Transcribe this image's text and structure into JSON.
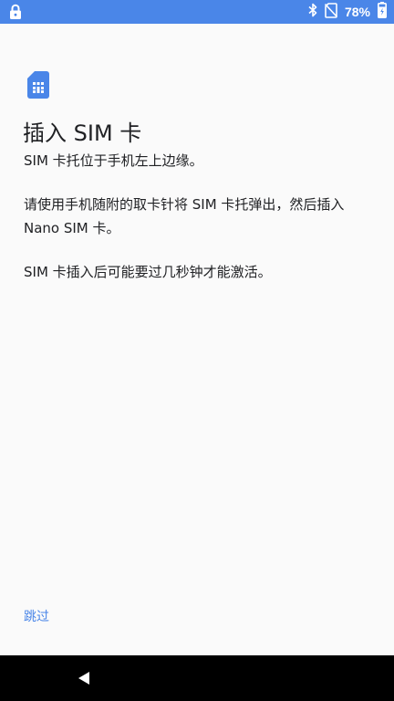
{
  "status_bar": {
    "lock_icon": "lock-icon",
    "bluetooth_icon": "bluetooth-icon",
    "no_sim_icon": "no-sim-icon",
    "battery_percent": "78%",
    "battery_icon": "battery-charging-icon",
    "background_color": "#4a86e8"
  },
  "main": {
    "icon": "sim-card-icon",
    "accent_color": "#4a86e8",
    "title": "插入 SIM 卡",
    "paragraphs": [
      "SIM 卡托位于手机左上边缘。",
      "请使用手机随附的取卡针将 SIM 卡托弹出，然后插入 Nano SIM 卡。",
      "SIM 卡插入后可能要过几秒钟才能激活。"
    ],
    "skip_label": "跳过"
  },
  "nav_bar": {
    "back_icon": "back-triangle-icon"
  }
}
